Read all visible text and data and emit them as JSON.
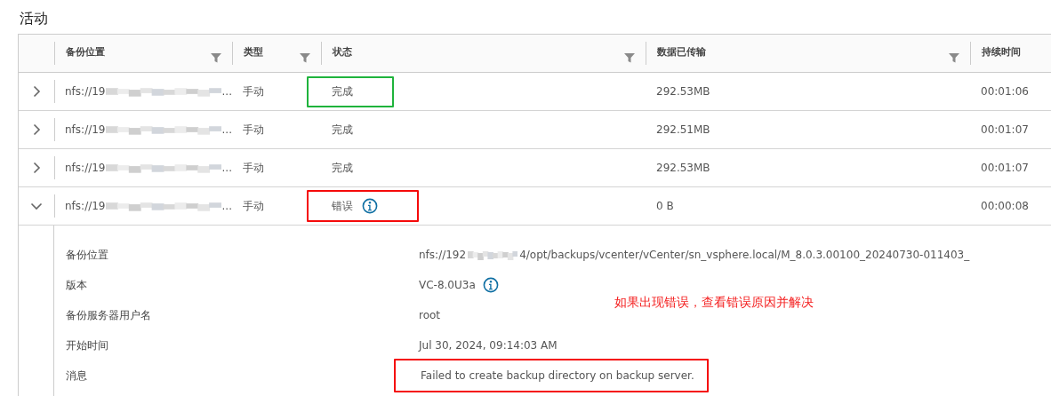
{
  "title": "活动",
  "table": {
    "columns": [
      {
        "label": "备份位置",
        "filter": true
      },
      {
        "label": "类型",
        "filter": true
      },
      {
        "label": "状态",
        "filter": true
      },
      {
        "label": "数据已传输",
        "filter": true
      },
      {
        "label": "持续时间",
        "filter": false
      }
    ],
    "rows": [
      {
        "expanded": false,
        "location": "nfs://19",
        "location_end": "...",
        "type": "手动",
        "status": "完成",
        "status_info": false,
        "highlighted": true,
        "color": "#1fb33c",
        "transferred": "292.53MB",
        "duration": "00:01:06"
      },
      {
        "expanded": false,
        "location": "nfs://19",
        "location_end": "...",
        "type": "手动",
        "status": "完成",
        "status_info": false,
        "highlighted": false,
        "transferred": "292.51MB",
        "duration": "00:01:07"
      },
      {
        "expanded": false,
        "location": "nfs://19",
        "location_end": "...",
        "type": "手动",
        "status": "完成",
        "status_info": false,
        "highlighted": false,
        "transferred": "292.53MB",
        "duration": "00:01:07"
      },
      {
        "expanded": true,
        "location": "nfs://19",
        "location_end": "...",
        "type": "手动",
        "status": "错误",
        "status_info": true,
        "highlighted": true,
        "color": "#f50b0b",
        "transferred": "0 B",
        "duration": "00:00:08",
        "details": [
          {
            "label": "备份位置",
            "value": "nfs://192",
            "value_end": "4/opt/backups/vcenter/vCenter/sn_vsphere.local/M_8.0.3.00100_20240730-011403_",
            "info": false,
            "highlighted": false
          },
          {
            "label": "版本",
            "value": "VC-8.0U3a",
            "info": true,
            "highlighted": false
          },
          {
            "label": "备份服务器用户名",
            "value": "root",
            "info": false,
            "highlighted": false
          },
          {
            "label": "开始时间",
            "value": "Jul 30, 2024, 09:14:03 AM",
            "info": false,
            "highlighted": false
          },
          {
            "label": "消息",
            "value": "Failed to create backup directory on backup server.",
            "info": false,
            "highlighted": true,
            "color": "#f50b0b"
          }
        ]
      }
    ]
  },
  "annotation": "如果出现错误，查看错误原因并解决"
}
